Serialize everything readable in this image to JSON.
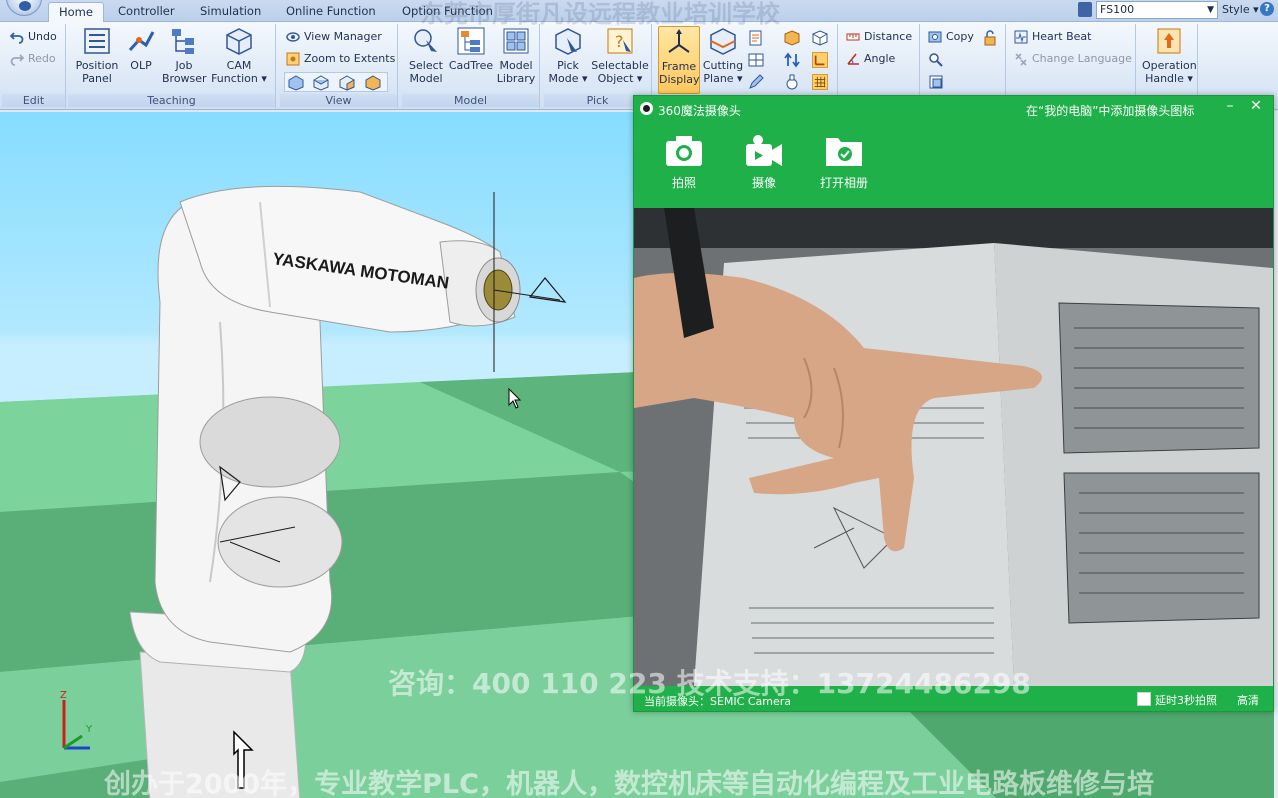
{
  "tabs": [
    {
      "label": "Home",
      "active": true
    },
    {
      "label": "Controller",
      "active": false
    },
    {
      "label": "Simulation",
      "active": false
    },
    {
      "label": "Online Function",
      "active": false
    },
    {
      "label": "Option Function",
      "active": false
    }
  ],
  "controller_select": {
    "value": "FS100"
  },
  "style_menu": {
    "label": "Style"
  },
  "help_icon": {
    "label": "?"
  },
  "ribbon": {
    "edit": {
      "label": "Edit",
      "undo": "Undo",
      "redo": "Redo"
    },
    "teaching": {
      "label": "Teaching",
      "position_panel": "Position\nPanel",
      "olp": "OLP",
      "job_browser": "Job\nBrowser",
      "cam_function": "CAM\nFunction"
    },
    "view": {
      "label": "View",
      "view_manager": "View Manager",
      "zoom_extents": "Zoom to Extents"
    },
    "model": {
      "label": "Model",
      "select_model": "Select\nModel",
      "cadtree": "CadTree",
      "model_library": "Model\nLibrary"
    },
    "pick": {
      "label": "Pick",
      "pick_mode": "Pick\nMode",
      "selectable_object": "Selectable\nObject"
    },
    "frame_display": "Frame\nDisplay",
    "cutting_plane": "Cutting\nPlane",
    "distance": "Distance",
    "angle": "Angle",
    "copy": "Copy",
    "heart_beat": "Heart Beat",
    "change_language": "Change Language",
    "operation_handle": "Operation\nHandle"
  },
  "viewport": {
    "robot_brand": "YASKAWA MOTOMAN",
    "axis_labels": {
      "z": "Z",
      "y": "Y"
    }
  },
  "watermarks": {
    "top": "东莞市厚街凡设远程教业培训学校",
    "middle": "咨询：400 110 223  技术支持：13724486298",
    "bottom": "创办于2000年，专业教学PLC，机器人，数控机床等自动化编程及工业电路板维修与培"
  },
  "camera_window": {
    "title": "360魔法摄像头",
    "add_link": "在“我的电脑”中添加摄像头图标",
    "minimize": "–",
    "close": "✕",
    "tools": [
      {
        "label": "拍照",
        "icon": "camera-icon"
      },
      {
        "label": "摄像",
        "icon": "video-camera-icon"
      },
      {
        "label": "打开相册",
        "icon": "folder-check-icon"
      }
    ],
    "current_camera": "当前摄像头：SEMIC Camera",
    "delay_label": "延时3秒拍照",
    "delay_checked": false,
    "quality": "高清"
  },
  "colors": {
    "camera_green": "#1fb04a",
    "sky": "#86ddff",
    "floor_light": "#7bcf9b",
    "floor_dark": "#4fa86e",
    "ribbon_active": "#ffc85c"
  }
}
